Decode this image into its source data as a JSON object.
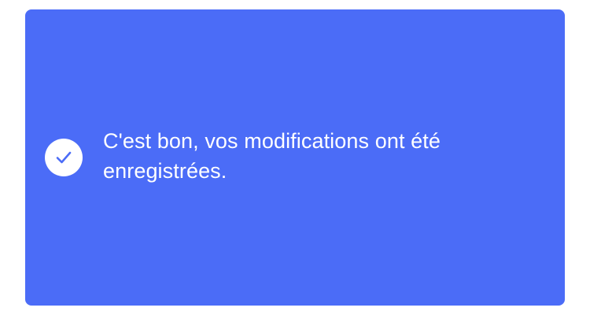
{
  "toast": {
    "icon": "check-circle-icon",
    "message": "C'est bon, vos modifications ont été enregistrées.",
    "colors": {
      "background": "#4b6cf7",
      "icon_background": "#ffffff",
      "icon_check": "#4b6cf7",
      "text": "#ffffff"
    }
  }
}
